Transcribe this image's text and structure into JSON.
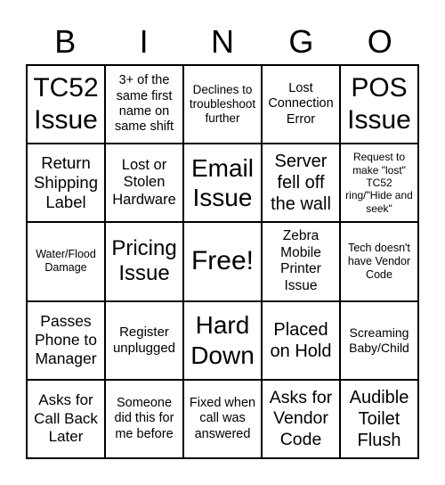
{
  "header": [
    "B",
    "I",
    "N",
    "G",
    "O"
  ],
  "cells": [
    {
      "text": "TC52 Issue",
      "size": 30
    },
    {
      "text": "3+ of the same first name on same shift",
      "size": 14.5
    },
    {
      "text": "Declines to troubleshoot further",
      "size": 13.5
    },
    {
      "text": "Lost Connection Error",
      "size": 14.5
    },
    {
      "text": "POS Issue",
      "size": 30
    },
    {
      "text": "Return Shipping Label",
      "size": 18.5
    },
    {
      "text": "Lost or Stolen Hardware",
      "size": 16.5
    },
    {
      "text": "Email Issue",
      "size": 28
    },
    {
      "text": "Server fell off the wall",
      "size": 20
    },
    {
      "text": "Request to make \"lost\" TC52 ring/\"Hide and seek\"",
      "size": 12
    },
    {
      "text": "Water/Flood Damage",
      "size": 12.5
    },
    {
      "text": "Pricing Issue",
      "size": 24
    },
    {
      "text": "Free!",
      "size": 30
    },
    {
      "text": "Zebra Mobile Printer Issue",
      "size": 15.5
    },
    {
      "text": "Tech doesn't have Vendor Code",
      "size": 12.5
    },
    {
      "text": "Passes Phone to Manager",
      "size": 17.5
    },
    {
      "text": "Register unplugged",
      "size": 15
    },
    {
      "text": "Hard Down",
      "size": 28
    },
    {
      "text": "Placed on Hold",
      "size": 20
    },
    {
      "text": "Screaming Baby/Child",
      "size": 14
    },
    {
      "text": "Asks for Call Back Later",
      "size": 17
    },
    {
      "text": "Someone did this for me before",
      "size": 14.5
    },
    {
      "text": "Fixed when call was answered",
      "size": 14.5
    },
    {
      "text": "Asks for Vendor Code",
      "size": 19.5
    },
    {
      "text": "Audible Toilet Flush",
      "size": 20
    }
  ]
}
